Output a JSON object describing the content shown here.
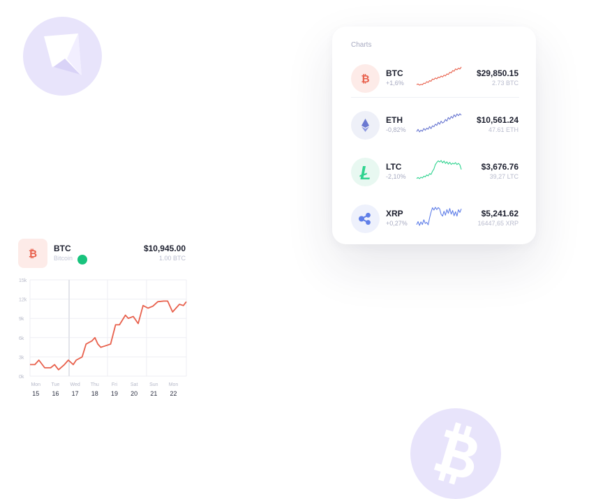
{
  "colors": {
    "accent_bg": "#e8e4fb",
    "accent_fg": "#ffffff",
    "btc": "#e8604c",
    "eth": "#6a78d1",
    "ltc": "#2fd38f",
    "xrp": "#5f7ee8",
    "online": "#19c37d"
  },
  "decor": {
    "top_left_icon": "ethereum-icon",
    "bottom_right_icon": "bitcoin-icon"
  },
  "charts_card": {
    "title": "Charts",
    "rows": [
      {
        "symbol": "BTC",
        "change": "+1,6%",
        "price": "$29,850.15",
        "amount": "2.73 BTC",
        "icon": "bitcoin-icon",
        "icon_bg": "#fdebe8",
        "color": "#e8604c",
        "trend": [
          3,
          3.5,
          2.6,
          3.2,
          2.9,
          4.1,
          3.8,
          5.2,
          4.6,
          6.0,
          5.5,
          7.2,
          6.8,
          8.0,
          7.3,
          8.6,
          8.2,
          9.4,
          8.7,
          10.1,
          9.5,
          11.0,
          10.6,
          12.2,
          11.8,
          13.5,
          13.0,
          14.8,
          14.1,
          15.3,
          14.7,
          16.2
        ]
      },
      {
        "symbol": "ETH",
        "change": "-0,82%",
        "price": "$10,561.24",
        "amount": "47.61 ETH",
        "icon": "ethereum-icon",
        "icon_bg": "#eef0f8",
        "color": "#6a78d1",
        "trend": [
          4,
          5.5,
          3.8,
          5.0,
          4.2,
          6.1,
          4.9,
          6.3,
          5.6,
          7.4,
          6.0,
          7.9,
          7.2,
          9.0,
          8.1,
          10.2,
          8.9,
          11.0,
          9.7,
          10.4,
          12.1,
          11.0,
          13.4,
          12.2,
          14.1,
          13.0,
          15.2,
          13.9,
          15.8,
          14.6,
          15.9,
          14.9
        ]
      },
      {
        "symbol": "LTC",
        "change": "-2,10%",
        "price": "$3,676.76",
        "amount": "39,27 LTC",
        "icon": "litecoin-icon",
        "icon_bg": "#e8f8f1",
        "color": "#2fd38f",
        "trend": [
          4,
          4.6,
          3.9,
          4.8,
          4.3,
          5.4,
          5.0,
          6.2,
          5.6,
          7.0,
          6.5,
          8.4,
          9.8,
          12.5,
          13.8,
          14.8,
          14.1,
          15.0,
          13.6,
          14.7,
          13.2,
          14.2,
          12.8,
          13.9,
          12.6,
          13.4,
          12.9,
          13.7,
          12.5,
          13.3,
          12.4,
          9.5
        ]
      },
      {
        "symbol": "XRP",
        "change": "+0,27%",
        "price": "$5,241.62",
        "amount": "16447,65 XRP",
        "icon": "ripple-icon",
        "icon_bg": "#eef1fc",
        "color": "#5f7ee8",
        "trend": [
          4,
          6.0,
          3.5,
          5.8,
          4.1,
          7.2,
          4.8,
          5.5,
          3.9,
          8.4,
          12.2,
          15.1,
          13.6,
          15.4,
          13.9,
          15.2,
          14.3,
          10.8,
          9.6,
          12.8,
          10.2,
          13.9,
          11.4,
          14.6,
          10.9,
          13.3,
          9.8,
          12.5,
          9.6,
          13.8,
          12.0,
          14.4
        ]
      }
    ]
  },
  "detail": {
    "symbol": "BTC",
    "name": "Bitcoin",
    "status": "online",
    "price": "$10,945.00",
    "amount": "1.00 BTC",
    "icon": "bitcoin-icon"
  },
  "chart_data": {
    "type": "line",
    "title": "",
    "xlabel": "",
    "ylabel": "",
    "grid": true,
    "ylim": [
      0,
      15
    ],
    "y_ticks": [
      {
        "value": 0,
        "label": "0k"
      },
      {
        "value": 3,
        "label": "3k"
      },
      {
        "value": 6,
        "label": "6k"
      },
      {
        "value": 9,
        "label": "9k"
      },
      {
        "value": 12,
        "label": "12k"
      },
      {
        "value": 15,
        "label": "15k"
      }
    ],
    "x_ticks": [
      {
        "x": 15,
        "day": "Mon",
        "date": "15"
      },
      {
        "x": 16,
        "day": "Tue",
        "date": "16"
      },
      {
        "x": 17,
        "day": "Wed",
        "date": "17"
      },
      {
        "x": 18,
        "day": "Thu",
        "date": "18"
      },
      {
        "x": 19,
        "day": "Fri",
        "date": "19"
      },
      {
        "x": 20,
        "day": "Sat",
        "date": "20"
      },
      {
        "x": 21,
        "day": "Sun",
        "date": "21"
      },
      {
        "x": 22,
        "day": "Mon",
        "date": "22"
      }
    ],
    "xlim": [
      14.6,
      22.55
    ],
    "series": [
      {
        "color": "#e8604c",
        "x": [
          14.6,
          14.85,
          15.05,
          15.35,
          15.65,
          15.85,
          16.05,
          16.35,
          16.55,
          16.8,
          16.95,
          17.25,
          17.45,
          17.75,
          17.9,
          18.05,
          18.2,
          18.4,
          18.7,
          18.95,
          19.15,
          19.45,
          19.6,
          19.85,
          20.1,
          20.35,
          20.6,
          20.85,
          21.1,
          21.4,
          21.6,
          21.85,
          22.2,
          22.4,
          22.55
        ],
        "y": [
          1.8,
          1.8,
          2.5,
          1.3,
          1.3,
          1.8,
          1.0,
          1.8,
          2.5,
          1.8,
          2.5,
          3.0,
          5.0,
          5.5,
          6.0,
          5.0,
          4.5,
          4.7,
          5.0,
          8.0,
          8.0,
          9.5,
          9.0,
          9.3,
          8.2,
          11.0,
          10.6,
          10.9,
          11.6,
          11.7,
          11.7,
          10.0,
          11.2,
          11.0,
          11.6
        ]
      }
    ]
  }
}
